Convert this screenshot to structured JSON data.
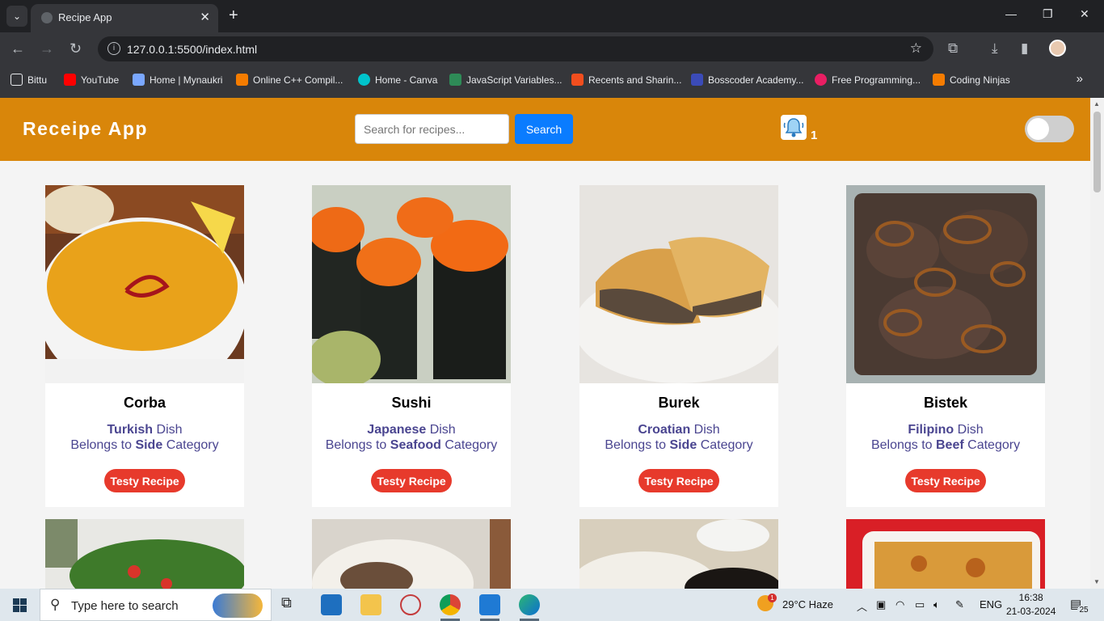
{
  "browser": {
    "tab_title": "Recipe App",
    "url": "127.0.0.1:5500/index.html",
    "bookmarks": [
      "Bittu",
      "YouTube",
      "Home | Mynaukri",
      "Online C++ Compil...",
      "Home - Canva",
      "JavaScript Variables...",
      "Recents and Sharin...",
      "Bosscoder Academy...",
      "Free Programming...",
      "Coding Ninjas"
    ]
  },
  "app": {
    "brand": "Receipe App",
    "search_placeholder": "Search for recipes...",
    "search_button": "Search",
    "notification_count": "1",
    "dark_mode_on": false
  },
  "recipes": [
    {
      "name": "Corba",
      "area": "Turkish",
      "dish": "Dish",
      "belongs": "Belongs to",
      "category": "Side",
      "category_suffix": "Category",
      "button": "Testy Recipe"
    },
    {
      "name": "Sushi",
      "area": "Japanese",
      "dish": "Dish",
      "belongs": "Belongs to",
      "category": "Seafood",
      "category_suffix": "Category",
      "button": "Testy Recipe"
    },
    {
      "name": "Burek",
      "area": "Croatian",
      "dish": "Dish",
      "belongs": "Belongs to",
      "category": "Side",
      "category_suffix": "Category",
      "button": "Testy Recipe"
    },
    {
      "name": "Bistek",
      "area": "Filipino",
      "dish": "Dish",
      "belongs": "Belongs to",
      "category": "Beef",
      "category_suffix": "Category",
      "button": "Testy Recipe"
    }
  ],
  "taskbar": {
    "search_placeholder": "Type here to search",
    "weather": "29°C  Haze",
    "weather_badge": "1",
    "language": "ENG",
    "time": "16:38",
    "date": "21-03-2024",
    "notifications": "25"
  }
}
